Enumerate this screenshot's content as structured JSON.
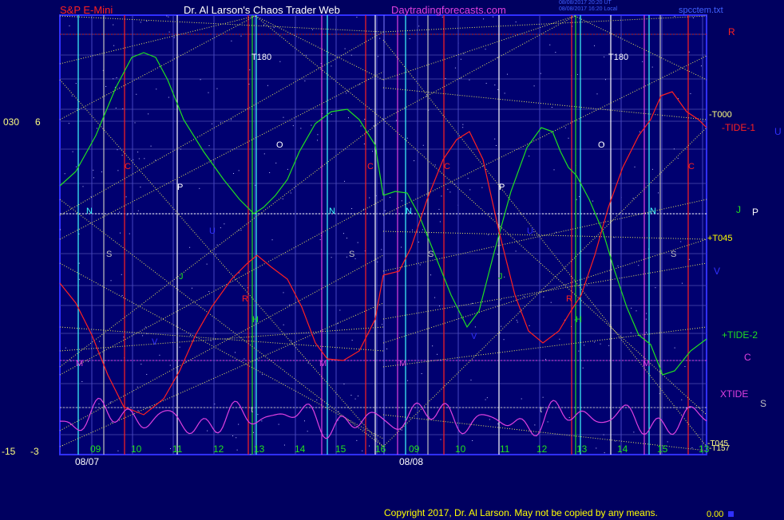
{
  "header": {
    "symbol": "S&P E-Mini",
    "title": "Dr. Al Larson's Chaos Trader Web",
    "site": "Daytradingforecasts.com",
    "stamp_line1": "08/08/2017 20:20 UT",
    "stamp_line2": "08/08/2017 16:20 Local",
    "file": "spcctem.txt"
  },
  "left_axis": {
    "upper_a": "030",
    "upper_b": "6",
    "lower_a": "-15",
    "lower_b": "-3"
  },
  "right_labels": {
    "r": "R",
    "t000": "-T000",
    "tide1": "-TIDE-1",
    "u": "U",
    "j": "J",
    "p": "P",
    "t045": "+T045",
    "v": "V",
    "tide2": "+TIDE-2",
    "c": "C",
    "xtide": "XTIDE",
    "s": "S",
    "t045b": "-T045",
    "t157": "-T157",
    "t13": "13"
  },
  "dates": {
    "day1": "08/07",
    "day2": "08/08"
  },
  "hour_ticks": [
    "09",
    "10",
    "11",
    "12",
    "13",
    "14",
    "15",
    "16",
    "09",
    "10",
    "11",
    "12",
    "13",
    "14",
    "15",
    "13"
  ],
  "line_markers": [
    "N",
    "S",
    "J",
    "V",
    "M",
    "C",
    "P",
    "O",
    "R",
    "H",
    "T180",
    "t",
    "U"
  ],
  "footer": {
    "copyright": "Copyright 2017, Dr. Al Larson. May not be copied by any means.",
    "value": "0.00"
  },
  "chart_data": {
    "type": "line",
    "x": [
      "08/07 08:30",
      "09:00",
      "10:00",
      "11:00",
      "12:00",
      "13:00",
      "14:00",
      "15:00",
      "16:00",
      "08/08 08:30",
      "09:00",
      "10:00",
      "11:00",
      "12:00",
      "13:00",
      "14:00",
      "15:00",
      "16:00"
    ],
    "series": [
      {
        "name": "-TIDE-1",
        "color": "#ff2020"
      },
      {
        "name": "+TIDE-2",
        "color": "#20e020"
      },
      {
        "name": "XTIDE",
        "color": "#e040e0"
      }
    ],
    "colors": {
      "background": "#000060",
      "grid": "#3a3aa0",
      "trend": "#e8e860",
      "red": "#ff2020",
      "green": "#20e020",
      "magenta": "#e040e0",
      "cyan": "#40ffff"
    }
  }
}
